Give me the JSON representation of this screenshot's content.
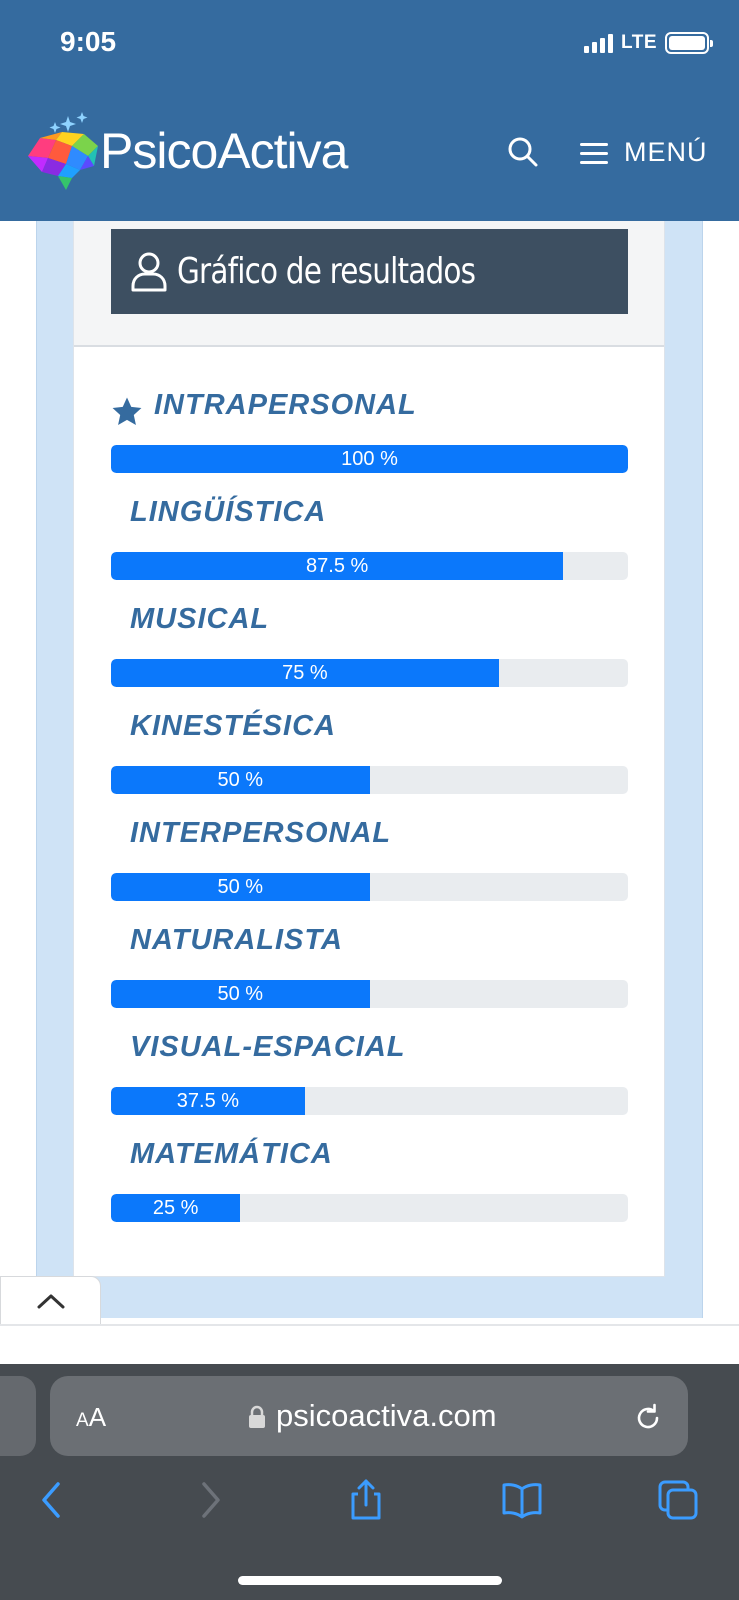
{
  "status_bar": {
    "time": "9:05",
    "network": "LTE"
  },
  "header": {
    "brand": "PsicoActiva",
    "menu_label": "MENÚ"
  },
  "panel": {
    "title": "Gráfico de resultados"
  },
  "results": [
    {
      "label": "INTRAPERSONAL",
      "percent": 100,
      "percent_text": "100 %",
      "starred": true
    },
    {
      "label": "LINGÜÍSTICA",
      "percent": 87.5,
      "percent_text": "87.5 %",
      "starred": false
    },
    {
      "label": "MUSICAL",
      "percent": 75,
      "percent_text": "75 %",
      "starred": false
    },
    {
      "label": "KINESTÉSICA",
      "percent": 50,
      "percent_text": "50 %",
      "starred": false
    },
    {
      "label": "INTERPERSONAL",
      "percent": 50,
      "percent_text": "50 %",
      "starred": false
    },
    {
      "label": "NATURALISTA",
      "percent": 50,
      "percent_text": "50 %",
      "starred": false
    },
    {
      "label": "VISUAL-ESPACIAL",
      "percent": 37.5,
      "percent_text": "37.5 %",
      "starred": false
    },
    {
      "label": "MATEMÁTICA",
      "percent": 25,
      "percent_text": "25 %",
      "starred": false
    }
  ],
  "browser": {
    "text_size_big": "A",
    "text_size_small": "A",
    "url": "psicoactiva.com"
  },
  "colors": {
    "header_bg": "#356b9f",
    "bar_fill": "#0b78fb",
    "bar_track": "#e9ecef",
    "label_text": "#356b9f",
    "title_bg": "#3d4f61"
  },
  "icons": [
    "brain-logo-icon",
    "search-icon",
    "hamburger-icon",
    "user-icon",
    "star-icon",
    "chevron-up-icon",
    "lock-icon",
    "reload-icon",
    "back-icon",
    "forward-icon",
    "share-icon",
    "bookmarks-icon",
    "tabs-icon"
  ]
}
